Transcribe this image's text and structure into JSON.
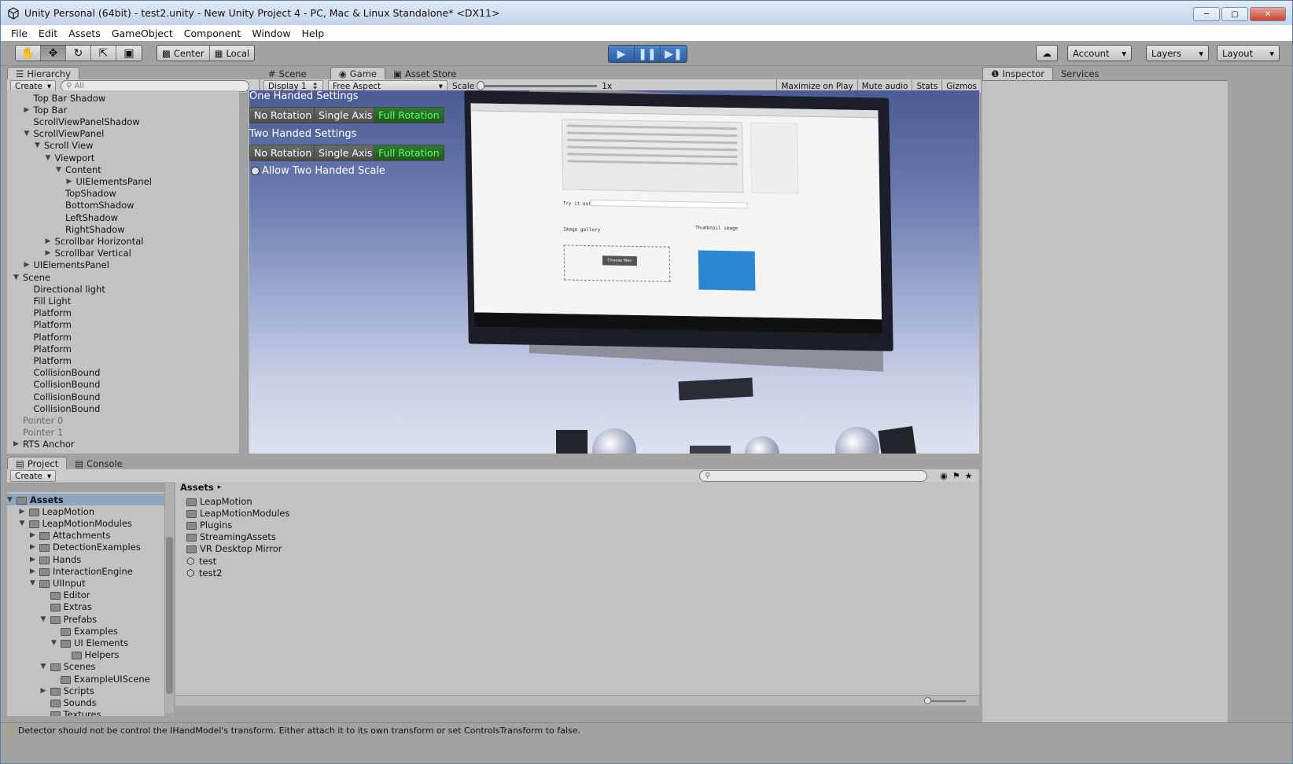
{
  "window": {
    "title": "Unity Personal (64bit) - test2.unity - New Unity Project 4 - PC, Mac & Linux Standalone* <DX11>"
  },
  "menu": [
    "File",
    "Edit",
    "Assets",
    "GameObject",
    "Component",
    "Window",
    "Help"
  ],
  "toolbar": {
    "pivot": "Center",
    "space": "Local",
    "account": "Account",
    "layers": "Layers",
    "layout": "Layout"
  },
  "hierarchy": {
    "tab": "Hierarchy",
    "create": "Create",
    "search_placeholder": "All",
    "rows": [
      {
        "label": "Top Bar Shadow",
        "depth": 2,
        "arrow": "",
        "grey": false
      },
      {
        "label": "Top Bar",
        "depth": 2,
        "arrow": "closed",
        "grey": false
      },
      {
        "label": "ScrollViewPanelShadow",
        "depth": 2,
        "arrow": "",
        "grey": false
      },
      {
        "label": "ScrollViewPanel",
        "depth": 2,
        "arrow": "open",
        "grey": false
      },
      {
        "label": "Scroll View",
        "depth": 3,
        "arrow": "open",
        "grey": false
      },
      {
        "label": "Viewport",
        "depth": 4,
        "arrow": "open",
        "grey": false
      },
      {
        "label": "Content",
        "depth": 5,
        "arrow": "open",
        "grey": false
      },
      {
        "label": "UIElementsPanel",
        "depth": 6,
        "arrow": "closed",
        "grey": false
      },
      {
        "label": "TopShadow",
        "depth": 5,
        "arrow": "",
        "grey": false
      },
      {
        "label": "BottomShadow",
        "depth": 5,
        "arrow": "",
        "grey": false
      },
      {
        "label": "LeftShadow",
        "depth": 5,
        "arrow": "",
        "grey": false
      },
      {
        "label": "RightShadow",
        "depth": 5,
        "arrow": "",
        "grey": false
      },
      {
        "label": "Scrollbar Horizontal",
        "depth": 4,
        "arrow": "closed",
        "grey": false
      },
      {
        "label": "Scrollbar Vertical",
        "depth": 4,
        "arrow": "closed",
        "grey": false
      },
      {
        "label": "UIElementsPanel",
        "depth": 2,
        "arrow": "closed",
        "grey": false
      },
      {
        "label": "Scene",
        "depth": 1,
        "arrow": "open",
        "grey": false
      },
      {
        "label": "Directional light",
        "depth": 2,
        "arrow": "",
        "grey": false
      },
      {
        "label": "Fill Light",
        "depth": 2,
        "arrow": "",
        "grey": false
      },
      {
        "label": "Platform",
        "depth": 2,
        "arrow": "",
        "grey": false
      },
      {
        "label": "Platform",
        "depth": 2,
        "arrow": "",
        "grey": false
      },
      {
        "label": "Platform",
        "depth": 2,
        "arrow": "",
        "grey": false
      },
      {
        "label": "Platform",
        "depth": 2,
        "arrow": "",
        "grey": false
      },
      {
        "label": "Platform",
        "depth": 2,
        "arrow": "",
        "grey": false
      },
      {
        "label": "CollisionBound",
        "depth": 2,
        "arrow": "",
        "grey": false
      },
      {
        "label": "CollisionBound",
        "depth": 2,
        "arrow": "",
        "grey": false
      },
      {
        "label": "CollisionBound",
        "depth": 2,
        "arrow": "",
        "grey": false
      },
      {
        "label": "CollisionBound",
        "depth": 2,
        "arrow": "",
        "grey": false
      },
      {
        "label": "Pointer 0",
        "depth": 1,
        "arrow": "",
        "grey": true
      },
      {
        "label": "Pointer 1",
        "depth": 1,
        "arrow": "",
        "grey": true
      },
      {
        "label": "RTS Anchor",
        "depth": 1,
        "arrow": "closed",
        "grey": false
      }
    ]
  },
  "center_tabs": {
    "scene": "Scene",
    "game": "Game",
    "asset_store": "Asset Store"
  },
  "game_bar": {
    "display": "Display 1",
    "aspect": "Free Aspect",
    "scale_label": "Scale",
    "scale_value": "1x",
    "maximize": "Maximize on Play",
    "mute": "Mute audio",
    "stats": "Stats",
    "gizmos": "Gizmos"
  },
  "game_ui": {
    "one_handed": "One Handed Settings",
    "two_handed": "Two Handed Settings",
    "no_rotation": "No Rotation",
    "single_axis": "Single Axis",
    "full_rotation": "Full Rotation",
    "allow_two_handed": "Allow Two Handed Scale",
    "screen_try_it_out": "Try it out",
    "screen_image_gallery": "Image gallery",
    "screen_thumbnail": "Thumbnail image",
    "screen_choose_files": "Choose files"
  },
  "inspector": {
    "tab": "Inspector",
    "services": "Services"
  },
  "project": {
    "tab": "Project",
    "console": "Console",
    "create": "Create",
    "tree": [
      {
        "label": "Assets",
        "depth": 0,
        "arrow": "open",
        "bold": true
      },
      {
        "label": "LeapMotion",
        "depth": 1,
        "arrow": "closed",
        "bold": false
      },
      {
        "label": "LeapMotionModules",
        "depth": 1,
        "arrow": "open",
        "bold": false
      },
      {
        "label": "Attachments",
        "depth": 2,
        "arrow": "closed",
        "bold": false
      },
      {
        "label": "DetectionExamples",
        "depth": 2,
        "arrow": "closed",
        "bold": false
      },
      {
        "label": "Hands",
        "depth": 2,
        "arrow": "closed",
        "bold": false
      },
      {
        "label": "InteractionEngine",
        "depth": 2,
        "arrow": "closed",
        "bold": false
      },
      {
        "label": "UIInput",
        "depth": 2,
        "arrow": "open",
        "bold": false
      },
      {
        "label": "Editor",
        "depth": 3,
        "arrow": "",
        "bold": false
      },
      {
        "label": "Extras",
        "depth": 3,
        "arrow": "",
        "bold": false
      },
      {
        "label": "Prefabs",
        "depth": 3,
        "arrow": "open",
        "bold": false
      },
      {
        "label": "Examples",
        "depth": 4,
        "arrow": "",
        "bold": false
      },
      {
        "label": "UI Elements",
        "depth": 4,
        "arrow": "open",
        "bold": false
      },
      {
        "label": "Helpers",
        "depth": 5,
        "arrow": "",
        "bold": false
      },
      {
        "label": "Scenes",
        "depth": 3,
        "arrow": "open",
        "bold": false
      },
      {
        "label": "ExampleUIScene",
        "depth": 4,
        "arrow": "",
        "bold": false
      },
      {
        "label": "Scripts",
        "depth": 3,
        "arrow": "closed",
        "bold": false
      },
      {
        "label": "Sounds",
        "depth": 3,
        "arrow": "",
        "bold": false
      },
      {
        "label": "Textures",
        "depth": 3,
        "arrow": "",
        "bold": false
      }
    ],
    "breadcrumb": "Assets",
    "items": [
      {
        "label": "LeapMotion",
        "kind": "folder"
      },
      {
        "label": "LeapMotionModules",
        "kind": "folder"
      },
      {
        "label": "Plugins",
        "kind": "folder"
      },
      {
        "label": "StreamingAssets",
        "kind": "folder"
      },
      {
        "label": "VR Desktop Mirror",
        "kind": "folder"
      },
      {
        "label": "test",
        "kind": "scene"
      },
      {
        "label": "test2",
        "kind": "scene"
      }
    ]
  },
  "status": {
    "message": "Detector should not be control the IHandModel's transform. Either attach it to its own transform or set ControlsTransform to false."
  }
}
